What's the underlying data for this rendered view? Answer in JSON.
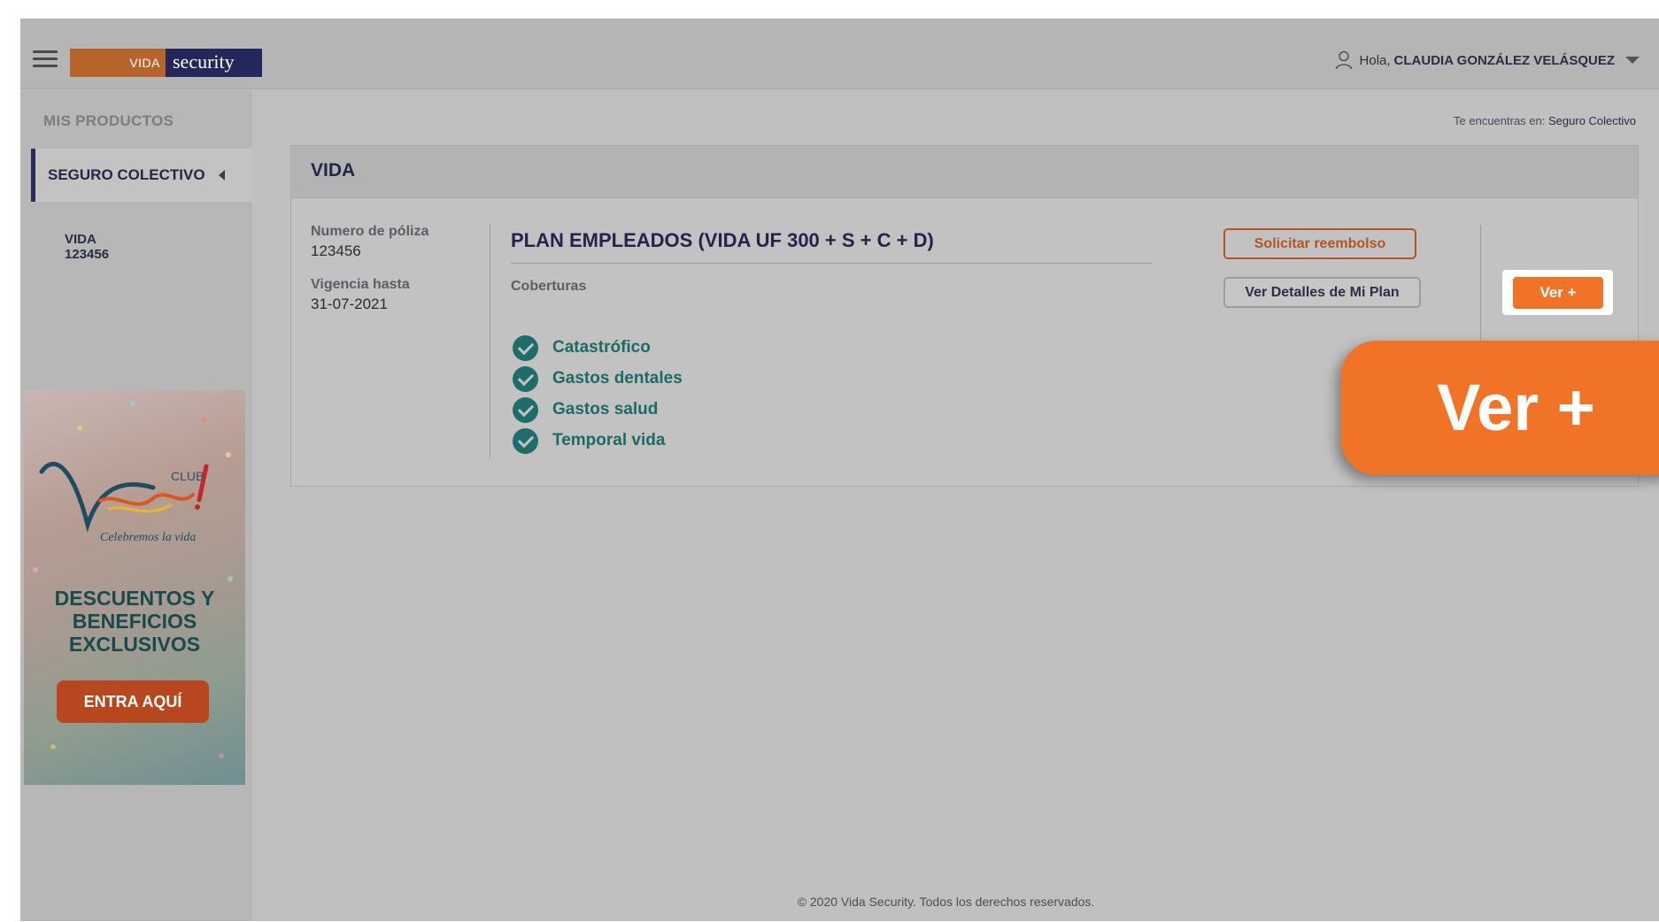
{
  "header": {
    "logo_left": "VIDA",
    "logo_right": "security",
    "greeting": "Hola,",
    "user_name": "CLAUDIA GONZÁLEZ VELÁSQUEZ"
  },
  "sidebar": {
    "title": "MIS PRODUCTOS",
    "active_item": "SEGURO COLECTIVO",
    "sub_item_line1": "VIDA",
    "sub_item_line2": "123456"
  },
  "promo": {
    "club_label": "CLUB",
    "brand": "Vive!",
    "tagline": "Celebremos la vida",
    "title_line1": "DESCUENTOS Y",
    "title_line2": "BENEFICIOS",
    "title_line3": "EXCLUSIVOS",
    "button": "ENTRA AQUÍ"
  },
  "breadcrumb": {
    "prefix": "Te encuentras en:",
    "current": "Seguro Colectivo"
  },
  "card": {
    "title": "VIDA",
    "policy_label": "Numero de póliza",
    "policy_value": "123456",
    "validity_label": "Vigencia hasta",
    "validity_value": "31-07-2021",
    "plan_name": "PLAN EMPLEADOS (VIDA UF 300 + S + C + D)",
    "coverages_label": "Coberturas",
    "coverages": [
      "Catastrófico",
      "Gastos dentales",
      "Gastos salud",
      "Temporal vida"
    ],
    "btn_reembolso": "Solicitar reembolso",
    "btn_detalles": "Ver Detalles de Mi Plan",
    "btn_ver": "Ver +"
  },
  "zoom_callout": {
    "label": "Ver +"
  },
  "footer": {
    "text": "© 2020 Vida Security. Todos los derechos reservados."
  },
  "colors": {
    "brand_orange": "#f07328",
    "brand_navy": "#24275c",
    "coverage_teal": "#1d6a66"
  }
}
